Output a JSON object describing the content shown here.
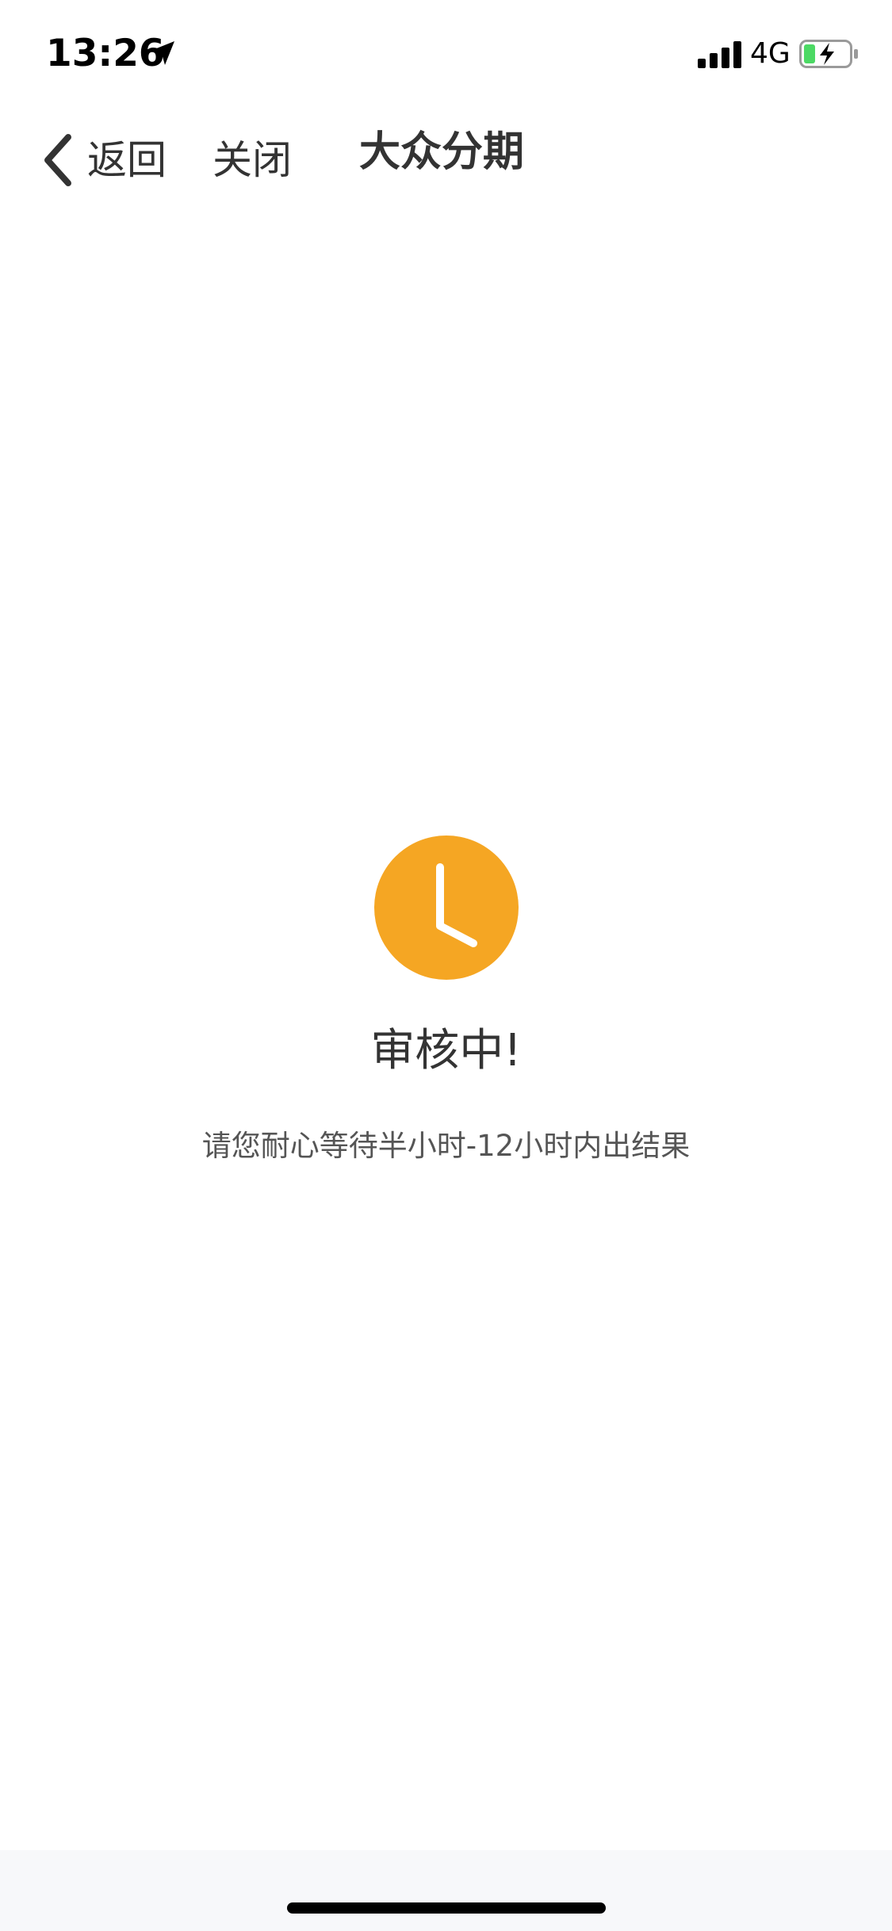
{
  "status_bar": {
    "time": "13:26",
    "network": "4G",
    "icons": {
      "location": "location-arrow-icon",
      "signal": "cellular-signal-icon",
      "battery": "battery-charging-icon"
    },
    "battery_color": "#4cd964"
  },
  "nav": {
    "back_label": "返回",
    "close_label": "关闭",
    "title": "大众分期"
  },
  "review": {
    "icon": "clock-icon",
    "icon_color": "#f5a623",
    "title": "审核中!",
    "description": "请您耐心等待半小时-12小时内出结果"
  }
}
